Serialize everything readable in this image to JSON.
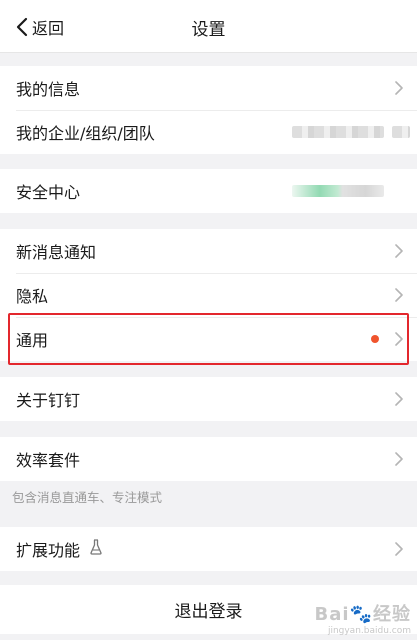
{
  "header": {
    "back_label": "返回",
    "title": "设置"
  },
  "groups": {
    "account": {
      "my_info": "我的信息",
      "my_org": "我的企业/组织/团队"
    },
    "security": {
      "security_center": "安全中心"
    },
    "notifications": {
      "new_msg": "新消息通知",
      "privacy": "隐私",
      "general": "通用"
    },
    "about": {
      "about_dingtalk": "关于钉钉"
    },
    "efficiency": {
      "efficiency_suite": "效率套件",
      "hint": "包含消息直通车、专注模式"
    },
    "extensions": {
      "extended_features": "扩展功能"
    }
  },
  "logout_label": "退出登录",
  "watermark": {
    "main": "Bai🐾经验",
    "sub": "jingyan.baidu.com"
  },
  "colors": {
    "highlight": "#e3272d",
    "badge_dot": "#f0542d",
    "background": "#f2f2f4"
  }
}
